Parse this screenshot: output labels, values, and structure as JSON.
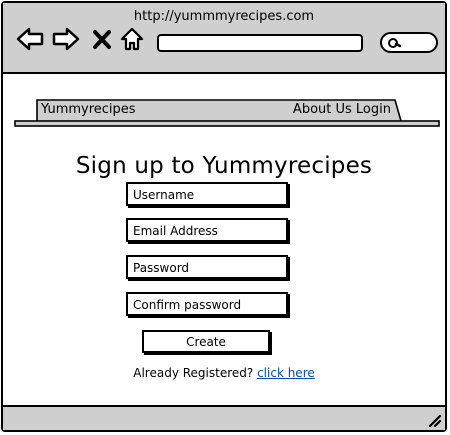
{
  "browser": {
    "url": "http://yummmyrecipes.com",
    "icons": [
      "back-arrow-icon",
      "forward-arrow-icon",
      "close-icon",
      "home-icon",
      "search-icon"
    ]
  },
  "navbar": {
    "brand": "Yummyrecipes",
    "about": "About Us",
    "login": "Login"
  },
  "form": {
    "title": "Sign up to Yummyrecipes",
    "username_placeholder": "Username",
    "email_placeholder": "Email Address",
    "password_placeholder": "Password",
    "confirm_placeholder": "Confirm password",
    "create_label": "Create",
    "already_text": "Already Registered?",
    "click_here": "click here"
  }
}
